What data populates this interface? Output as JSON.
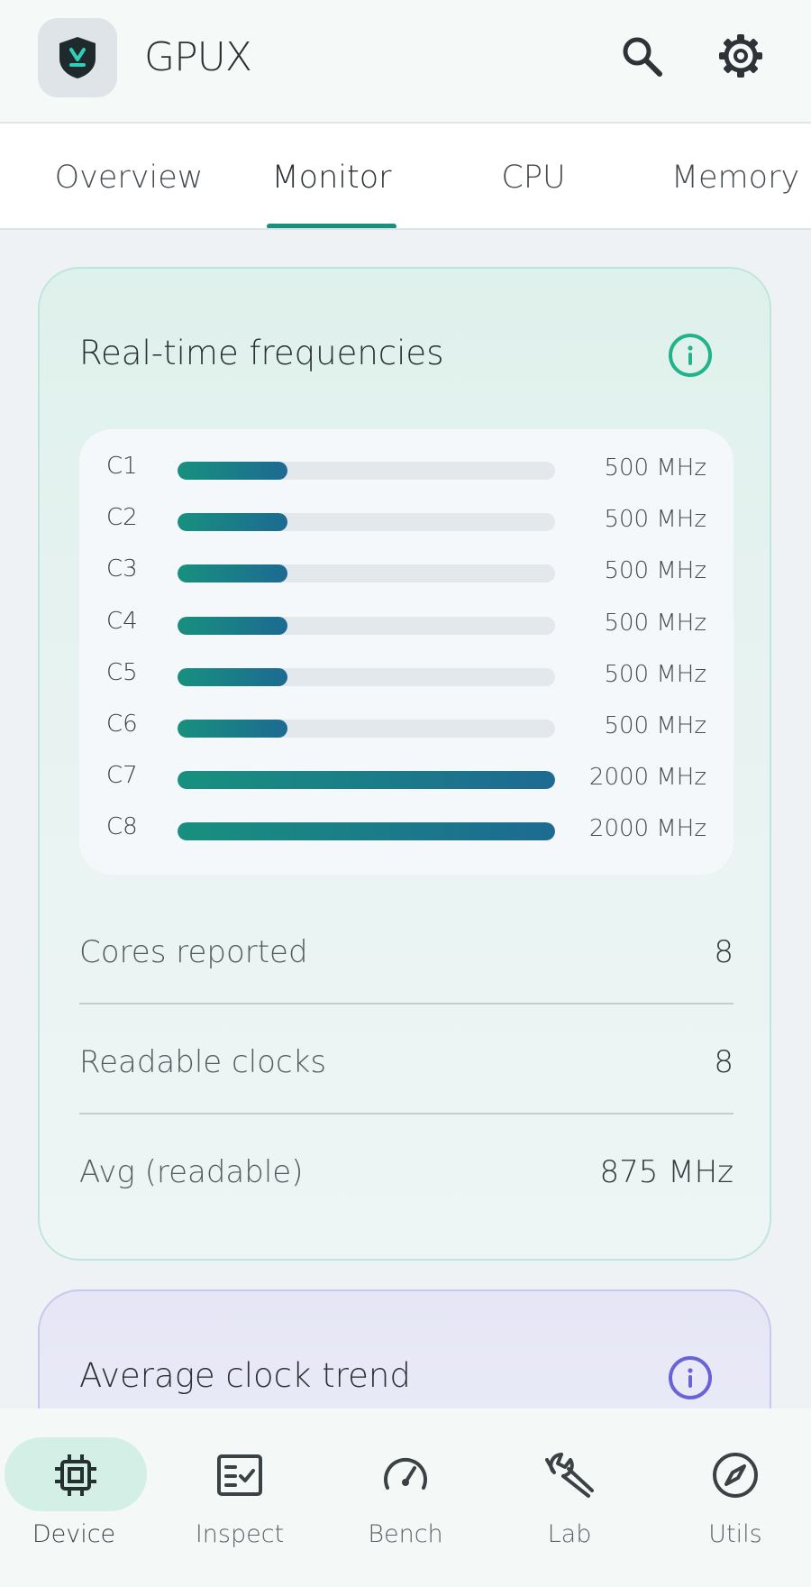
{
  "app": {
    "title": "GPUX",
    "icon": "shield-download-icon"
  },
  "header": {
    "search_icon": "search-icon",
    "settings_icon": "gear-icon"
  },
  "tabs": [
    {
      "label": "Overview",
      "active": false
    },
    {
      "label": "Monitor",
      "active": true
    },
    {
      "label": "CPU",
      "active": false
    },
    {
      "label": "Memory",
      "active": false
    }
  ],
  "realtime": {
    "title": "Real-time frequencies",
    "info_icon": "info-icon",
    "max_mhz": 2000,
    "cores": [
      {
        "label": "C1",
        "value": "500 MHz",
        "mhz": 500
      },
      {
        "label": "C2",
        "value": "500 MHz",
        "mhz": 500
      },
      {
        "label": "C3",
        "value": "500 MHz",
        "mhz": 500
      },
      {
        "label": "C4",
        "value": "500 MHz",
        "mhz": 500
      },
      {
        "label": "C5",
        "value": "500 MHz",
        "mhz": 500
      },
      {
        "label": "C6",
        "value": "500 MHz",
        "mhz": 500
      },
      {
        "label": "C7",
        "value": "2000 MHz",
        "mhz": 2000
      },
      {
        "label": "C8",
        "value": "2000 MHz",
        "mhz": 2000
      }
    ],
    "stats": [
      {
        "label": "Cores reported",
        "value": "8"
      },
      {
        "label": "Readable clocks",
        "value": "8"
      },
      {
        "label": "Avg (readable)",
        "value": "875 MHz"
      }
    ]
  },
  "trend": {
    "title": "Average clock trend",
    "info_icon": "info-icon"
  },
  "bottom_nav": [
    {
      "label": "Device",
      "icon": "chip-icon",
      "active": true
    },
    {
      "label": "Inspect",
      "icon": "checklist-icon",
      "active": false
    },
    {
      "label": "Bench",
      "icon": "gauge-icon",
      "active": false
    },
    {
      "label": "Lab",
      "icon": "wrench-icon",
      "active": false
    },
    {
      "label": "Utils",
      "icon": "compass-icon",
      "active": false
    }
  ],
  "colors": {
    "accent": "#16907f",
    "bar_start": "#18907e",
    "bar_end": "#1d6a92",
    "info_green": "#22b38a",
    "info_purple": "#6a62d8"
  }
}
